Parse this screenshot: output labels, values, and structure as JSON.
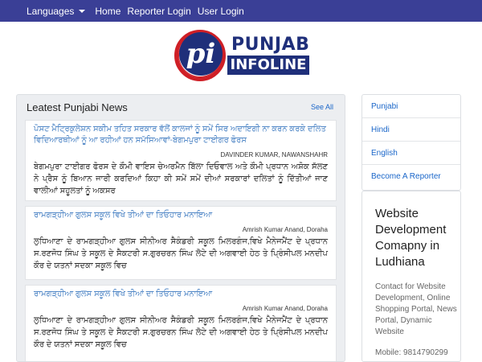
{
  "nav": {
    "languages": "Languages",
    "home": "Home",
    "reporter_login": "Reporter Login",
    "user_login": "User Login"
  },
  "logo": {
    "mark": "pi",
    "top": "PUNJAB",
    "bottom": "INFOLINE"
  },
  "news_panel": {
    "title": "Leatest Punjabi News",
    "see_all": "See All",
    "items": [
      {
        "title": "ਪੋਸਟ ਮੈਟ੍ਰਿਕੁਲੇਸ਼ਨ ਸਕੀਮ ਤਹਿਤ ਸਰਕਾਰ ਵੱਲੋਂ ਕਾਲਜਾਂ ਨੂੰ ਸਮੇਂ ਸਿਰ ਅਦਾਇਗੀ ਨਾ ਕਰਨ ਕਰਕੇ ਦਲਿਤ ਵਿਦਿਆਰਥੀਆਂ ਨੂੰ ਆ ਰਹੀਆਂ ਹਨ ਸਮੱਸਿਆਵਾਂ-ਬੇਗਮਪੁਰਾ ਟਾਈਗਰ ਫੋਰਸ",
        "author": "DAVINDER KUMAR, NAWANSHAHR",
        "text": "ਬੇਗਮਪੁਰਾ ਟਾਈਗਰ ਫੋਰਸ ਦੇ ਕੌਮੀ ਵਾਇਸ ਚੇਅਰਮੈਨ ਬਿੱਲਾ ਦਿਓਵਾਲ ਅਤੇ ਕੌਮੀ ਪ੍ਰਧਾਨ ਅਸ਼ੋਕ ਸੱਲਣ ਨੇ ਪ੍ਰੈਸ ਨੂੰ ਬਿਆਨ ਜਾਰੀ ਕਰਦਿਆਂ ਕਿਹਾ ਕੀ ਸਮੇਂ ਸਮੇਂ ਦੀਆਂ ਸਰਕਾਰਾਂ ਦਲਿਤਾਂ ਨੂੰ ਦਿੱਤੀਆਂ ਜਾਣ ਵਾਲੀਆਂ ਸਹੂਲਤਾਂ ਨੂੰ ਅਕਸਰ"
      },
      {
        "title": "ਰਾਮਗੜ੍ਹੀਆ ਗੁਲਸ ਸਕੂਲ ਵਿਖੇ ਤੀਆਂ ਦਾ ਤਿਓਹਾਰ ਮਨਾਇਆ",
        "author": "Amrish Kumar Anand, Doraha",
        "text": "ਲੁਧਿਆਣਾ ਦੇ ਰਾਮਗੜ੍ਹੀਆ ਗੁਲਸ ਸੀਨੀਅਰ ਸੈਕੰਡਰੀ ਸਕੂਲ ਮਿਲਰਗੰਜ,ਵਿਖੇ ਮੈਨੇਜਮੈਂਟ ਦੇ ਪ੍ਰਧਾਨ ਸ.ਰਣਜੋਧ ਸਿੰਘ ਤੇ ਸਕੂਲ ਦੇ ਸੈਕਟਰੀ ਸ.ਗੁਰਚਰਨ ਸਿੰਘ ਲੋਟੇ ਦੀ ਅਗਵਾਈ ਹੇਠ ਤੇ ਪ੍ਰਿੰਸੀਪਲ ਮਨਦੀਪ ਕੌਰ ਦੇ ਯਤਨਾਂ ਸਦਕਾ ਸਕੂਲ ਵਿਚ"
      },
      {
        "title": "ਰਾਮਗੜ੍ਹੀਆ ਗੁਲਸ ਸਕੂਲ ਵਿਖੇ ਤੀਆਂ ਦਾ ਤਿਓਹਾਰ ਮਨਾਇਆ",
        "author": "Amrish Kumar Anand, Doraha",
        "text": "ਲੁਧਿਆਣਾ ਦੇ ਰਾਮਗੜ੍ਹੀਆ ਗੁਲਸ ਸੀਨੀਅਰ ਸੈਕੰਡਰੀ ਸਕੂਲ ਮਿਲਰਗੰਜ,ਵਿਖੇ ਮੈਨੇਜਮੈਂਟ ਦੇ ਪ੍ਰਧਾਨ ਸ.ਰਣਜੋਧ ਸਿੰਘ ਤੇ ਸਕੂਲ ਦੇ ਸੈਕਟਰੀ ਸ.ਗੁਰਚਰਨ ਸਿੰਘ ਲੋਟੇ ਦੀ ਅਗਵਾਈ ਹੇਠ ਤੇ ਪ੍ਰਿੰਸੀਪਲ ਮਨਦੀਪ ਕੌਰ ਦੇ ਯਤਨਾਂ ਸਦਕਾ ਸਕੂਲ ਵਿਚ"
      }
    ]
  },
  "sidebar": {
    "items": [
      "Punjabi",
      "Hindi",
      "English",
      "Become A Reporter"
    ]
  },
  "ad": {
    "title": "Website Development Comapny in Ludhiana",
    "description": "Contact for Website Development, Online Shopping Portal, News Portal, Dynamic Website",
    "mobile": "Mobile: 9814790299"
  }
}
